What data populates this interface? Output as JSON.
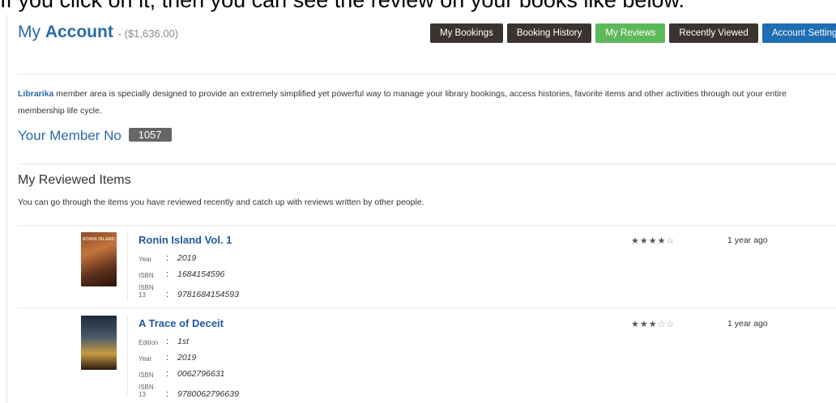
{
  "caption": "If you click on it, then you can see the review on your books like below.",
  "header": {
    "title_prefix": "My ",
    "title_strong": "Account",
    "balance": "- ($1,636.00)"
  },
  "nav": {
    "my_bookings": "My Bookings",
    "booking_history": "Booking History",
    "my_reviews": "My Reviews",
    "recently_viewed": "Recently Viewed",
    "account_settings": "Account Settings"
  },
  "intro": {
    "brand": "Librarika",
    "text": " member area is specially designed to provide an extremely simplified yet powerful way to manage your library bookings, access histories, favorite items and other activities through out your entire membership life cycle."
  },
  "member": {
    "label": "Your Member No",
    "number": "1057"
  },
  "reviewed": {
    "title": "My Reviewed Items",
    "subtitle": "You can go through the items you have reviewed recently and catch up with reviews written by other people."
  },
  "items": [
    {
      "title": "Ronin Island Vol. 1",
      "year_label": "Year",
      "year": "2019",
      "isbn_label": "ISBN",
      "isbn": "1684154596",
      "isbn13_label": "ISBN 13",
      "isbn13": "9781684154593",
      "rating": 4,
      "rating_max": 5,
      "time": "1 year ago"
    },
    {
      "title": "A Trace of Deceit",
      "edition_label": "Edition",
      "edition": "1st",
      "year_label": "Year",
      "year": "2019",
      "isbn_label": "ISBN",
      "isbn": "0062796631",
      "isbn13_label": "ISBN 13",
      "isbn13": "9780062796639",
      "rating": 3,
      "rating_max": 5,
      "time": "1 year ago"
    }
  ],
  "colors": {
    "link_blue": "#2a6aa8",
    "nav_dark": "#3b3330",
    "nav_active": "#5cb85c",
    "nav_settings": "#1f6db3"
  },
  "icons": {
    "star_filled": "star-filled-icon",
    "star_empty": "star-empty-icon"
  }
}
